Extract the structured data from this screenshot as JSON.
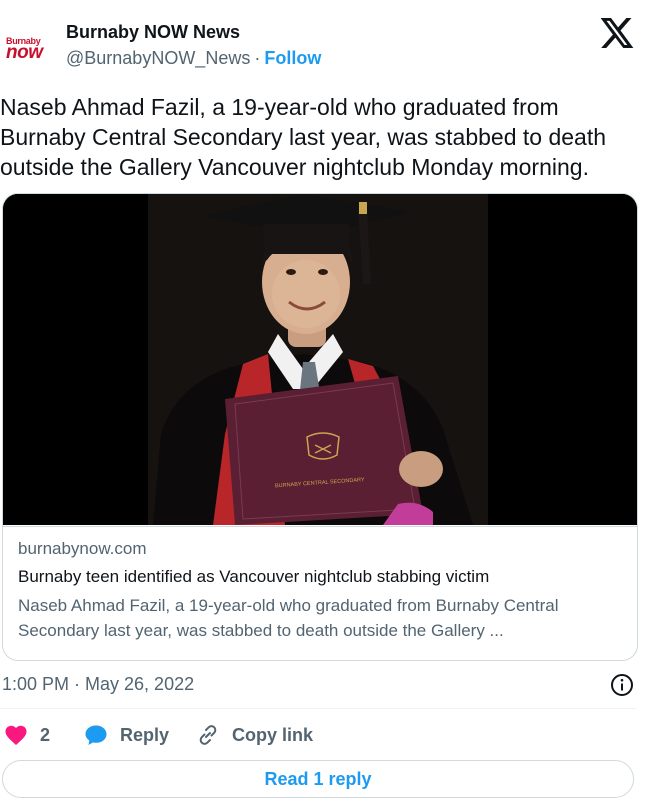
{
  "account": {
    "logo_top": "Burnaby",
    "logo_bottom": "now",
    "name": "Burnaby NOW News",
    "handle": "@BurnabyNOW_News",
    "separator": "·",
    "follow_label": "Follow"
  },
  "tweet": {
    "text": "Naseb Ahmad Fazil, a 19-year-old who graduated from Burnaby Central Secondary last year, was stabbed to death outside the Gallery Vancouver nightclub Monday morning.",
    "timestamp": "1:00 PM · May 26, 2022"
  },
  "card": {
    "domain": "burnabynow.com",
    "title": "Burnaby teen identified as Vancouver nightclub stabbing victim",
    "description": "Naseb Ahmad Fazil, a 19-year-old who graduated from Burnaby Central Secondary last year, was stabbed to death outside the Gallery ...",
    "diploma_text": "BURNABY CENTRAL SECONDARY"
  },
  "actions": {
    "like_count": "2",
    "reply_label": "Reply",
    "copy_link_label": "Copy link",
    "read_replies_label": "Read 1 reply"
  },
  "icons": {
    "x": "x-logo-icon",
    "like": "heart-icon",
    "reply": "speech-bubble-icon",
    "copy": "link-icon",
    "info": "info-icon"
  },
  "colors": {
    "brand_red": "#c8102e",
    "link_blue": "#1d9bf0",
    "like_pink": "#f91880",
    "text_primary": "#0f1419",
    "text_secondary": "#536471",
    "border": "#cfd9de"
  }
}
